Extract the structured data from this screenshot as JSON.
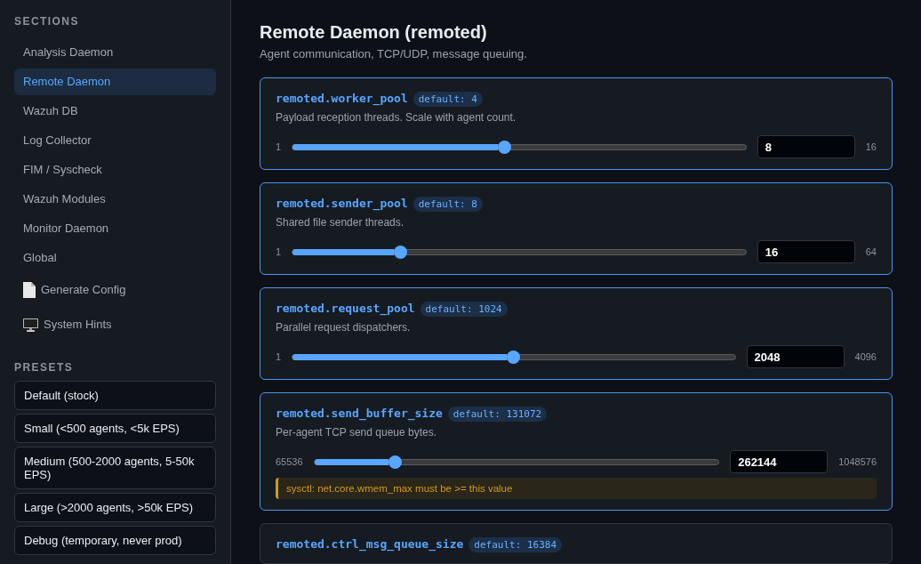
{
  "sidebar": {
    "sections_heading": "SECTIONS",
    "sections": [
      {
        "label": "Analysis Daemon",
        "selected": false,
        "kind": "section"
      },
      {
        "label": "Remote Daemon",
        "selected": true,
        "kind": "section"
      },
      {
        "label": "Wazuh DB",
        "selected": false,
        "kind": "section"
      },
      {
        "label": "Log Collector",
        "selected": false,
        "kind": "section"
      },
      {
        "label": "FIM / Syscheck",
        "selected": false,
        "kind": "section"
      },
      {
        "label": "Wazuh Modules",
        "selected": false,
        "kind": "section"
      },
      {
        "label": "Monitor Daemon",
        "selected": false,
        "kind": "section"
      },
      {
        "label": "Global",
        "selected": false,
        "kind": "section"
      },
      {
        "label": "Generate Config",
        "selected": false,
        "kind": "document"
      },
      {
        "label": "System Hints",
        "selected": false,
        "kind": "monitor"
      }
    ],
    "presets_heading": "PRESETS",
    "presets": [
      "Default (stock)",
      "Small (<500 agents, <5k EPS)",
      "Medium (500-2000 agents, 5-50k EPS)",
      "Large (>2000 agents, >50k EPS)",
      "Debug (temporary, never prod)"
    ]
  },
  "main": {
    "title": "Remote Daemon (remoted)",
    "subtitle": "Agent communication, TCP/UDP, message queuing.",
    "params": [
      {
        "name": "remoted.worker_pool",
        "default": "default: 4",
        "description": "Payload reception threads. Scale with agent count.",
        "min": "1",
        "max": "16",
        "value": "8",
        "level": 0.467,
        "modified": true
      },
      {
        "name": "remoted.sender_pool",
        "default": "default: 8",
        "description": "Shared file sender threads.",
        "min": "1",
        "max": "64",
        "value": "16",
        "level": 0.238,
        "modified": true
      },
      {
        "name": "remoted.request_pool",
        "default": "default: 1024",
        "description": "Parallel request dispatchers.",
        "min": "1",
        "max": "4096",
        "value": "2048",
        "level": 0.5,
        "modified": true
      },
      {
        "name": "remoted.send_buffer_size",
        "default": "default: 131072",
        "description": "Per-agent TCP send queue bytes.",
        "min": "65536",
        "max": "1048576",
        "value": "262144",
        "level": 0.2,
        "modified": true,
        "warning": "sysctl: net.core.wmem_max must be >= this value"
      },
      {
        "name": "remoted.ctrl_msg_queue_size",
        "default": "default: 16384",
        "modified": false
      }
    ]
  }
}
